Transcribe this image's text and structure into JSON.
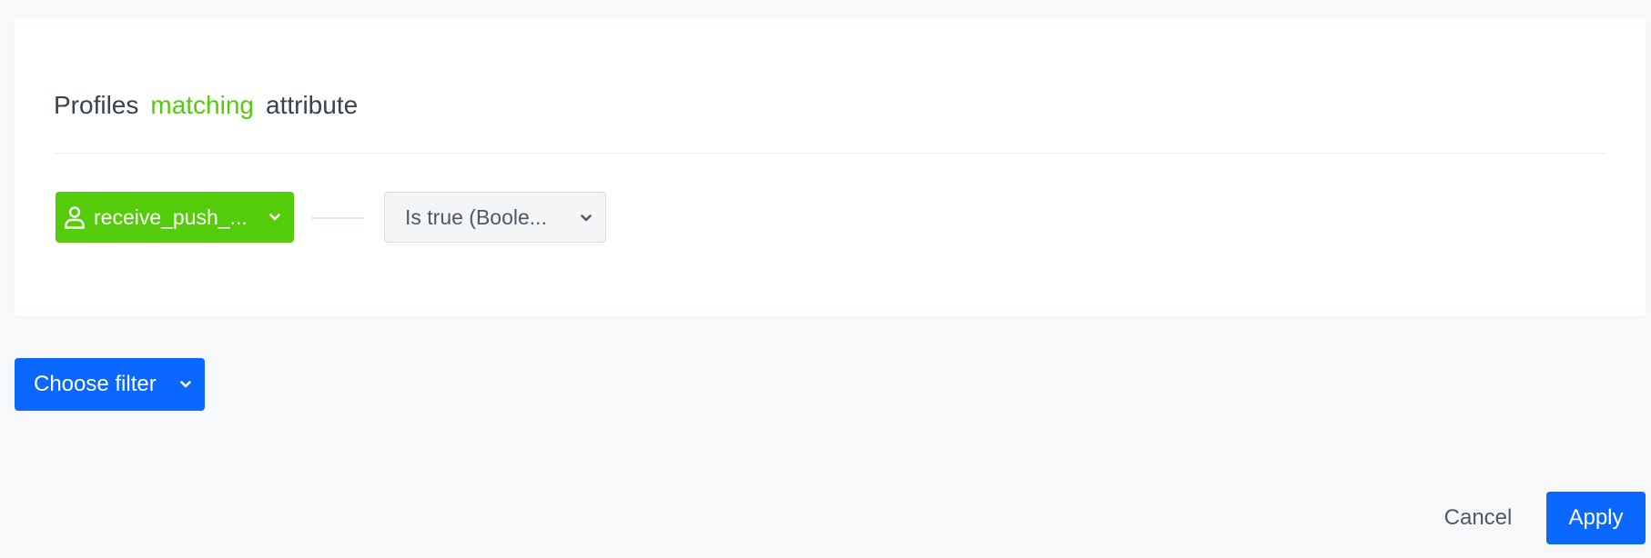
{
  "colors": {
    "accent_green": "#54cb0b",
    "primary_blue": "#0b68ff",
    "text_dark": "#384350",
    "text_muted": "#4e5967",
    "background": "#f7f8fa"
  },
  "filter_panel": {
    "title": {
      "prefix": "Profiles",
      "highlight": "matching",
      "suffix": "attribute"
    },
    "attribute_select": {
      "icon": "user-icon",
      "value": "receive_push_...",
      "dropdown_icon": "chevron-down-icon"
    },
    "operator_select": {
      "value": "Is true (Boole...",
      "dropdown_icon": "chevron-down-icon"
    }
  },
  "choose_filter": {
    "label": "Choose filter",
    "dropdown_icon": "chevron-down-icon"
  },
  "footer": {
    "cancel_label": "Cancel",
    "apply_label": "Apply"
  }
}
